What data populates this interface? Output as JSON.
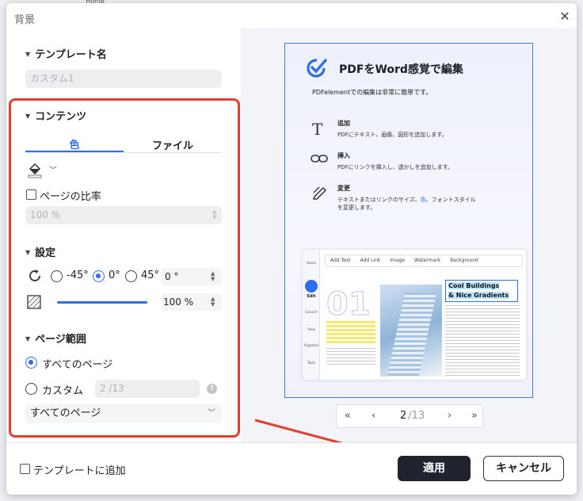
{
  "background_app": {
    "tab_label": "Home"
  },
  "dialog": {
    "title": "背景",
    "close_glyph": "✕"
  },
  "template": {
    "heading": "テンプレート名",
    "name_placeholder": "カスタム1"
  },
  "content": {
    "heading": "コンテンツ",
    "tabs": [
      {
        "label": "色",
        "active": true
      },
      {
        "label": "ファイル",
        "active": false
      }
    ],
    "color_picker_icon": "paint-bucket-icon",
    "page_ratio_label": "ページの比率",
    "page_ratio_checked": false,
    "page_ratio_value": "100 %"
  },
  "settings": {
    "heading": "設定",
    "rotation_options": [
      {
        "label": "-45°",
        "selected": false
      },
      {
        "label": "0°",
        "selected": true
      },
      {
        "label": "45°",
        "selected": false
      }
    ],
    "rotation_value": "0 °",
    "opacity_value": "100 %",
    "opacity_fraction": 1.0
  },
  "page_range": {
    "heading": "ページ範囲",
    "all_pages_label": "すべてのページ",
    "all_pages_selected": true,
    "custom_label": "カスタム",
    "custom_placeholder": "2 /13",
    "dropdown_value": "すべてのページ"
  },
  "preview": {
    "headline": "PDFをWord感覚で編集",
    "subline": "PDFelementでの編集は非常に簡単です。",
    "features": [
      {
        "title": "追加",
        "desc": "PDFにテキスト、画像、図形を追加します。"
      },
      {
        "title": "挿入",
        "desc": "PDFにリンクを挿入し、透かしを追加します。"
      },
      {
        "title": "変更",
        "desc_a": "テキストまたはリンクのサイズ、",
        "desc_color": "色",
        "desc_b": "、フォントスタイル",
        "desc_c": "を変更します。"
      }
    ],
    "toolbar": [
      "Add Text",
      "Add Link",
      "Image",
      "Watermark",
      "Background"
    ],
    "sidebar": [
      "Home",
      "Edit",
      "Convert",
      "View",
      "Organize",
      "Tools"
    ],
    "big_number": "01",
    "callout_line1": "Cool Buildings",
    "callout_line2": "& Nice Gradients",
    "accent": "#2d6df0",
    "highlight": "#f6e96b"
  },
  "pagination": {
    "first": "«",
    "prev": "‹",
    "current": "2",
    "total": "/13",
    "next": "›",
    "last": "»"
  },
  "footer": {
    "add_template_label": "テンプレートに追加",
    "add_template_checked": false,
    "apply_label": "適用",
    "cancel_label": "キャンセル"
  }
}
